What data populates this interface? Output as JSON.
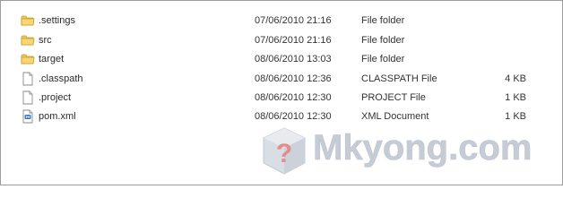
{
  "files": [
    {
      "name": ".settings",
      "date": "07/06/2010 21:16",
      "type": "File folder",
      "size": "",
      "icon": "folder-icon"
    },
    {
      "name": "src",
      "date": "07/06/2010 21:16",
      "type": "File folder",
      "size": "",
      "icon": "folder-icon"
    },
    {
      "name": "target",
      "date": "08/06/2010 13:03",
      "type": "File folder",
      "size": "",
      "icon": "folder-icon"
    },
    {
      "name": ".classpath",
      "date": "08/06/2010 12:36",
      "type": "CLASSPATH File",
      "size": "4 KB",
      "icon": "file-icon"
    },
    {
      "name": ".project",
      "date": "08/06/2010 12:30",
      "type": "PROJECT File",
      "size": "1 KB",
      "icon": "file-icon"
    },
    {
      "name": "pom.xml",
      "date": "08/06/2010 12:30",
      "type": "XML Document",
      "size": "1 KB",
      "icon": "xml-file-icon"
    }
  ],
  "watermark": {
    "text": "Mkyong.com",
    "color": "#c6ccd6"
  },
  "colors": {
    "folder": "#e8c04a",
    "border": "#9c9c9c"
  }
}
